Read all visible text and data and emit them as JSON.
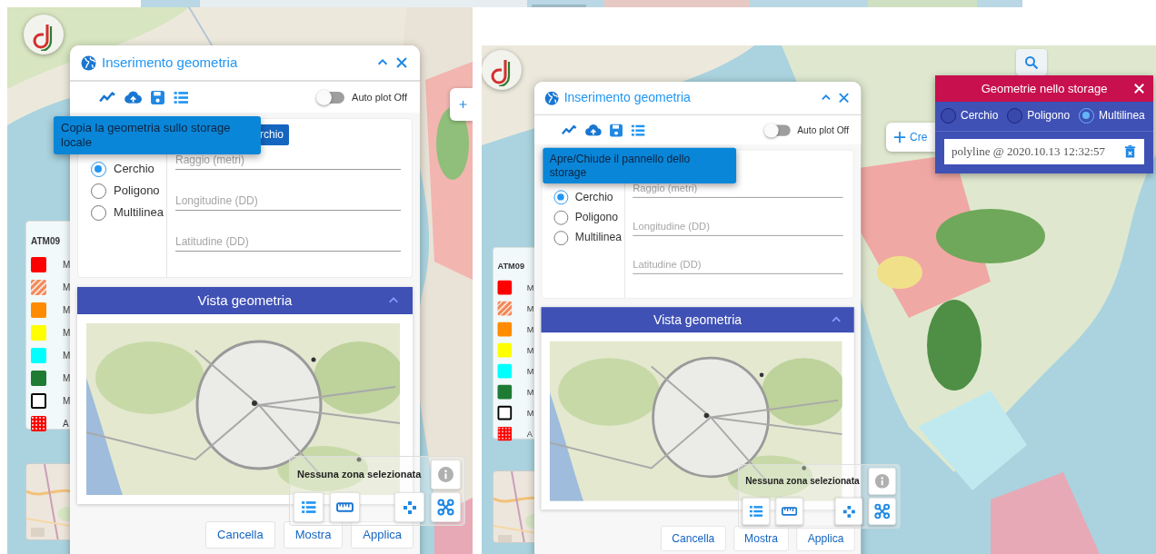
{
  "panes": [
    {
      "dialog": {
        "title": "Inserimento geometria",
        "auto_plot": {
          "label": "Auto plot Off",
          "on": false
        },
        "tooltip": "Copia la geometria sullo storage locale",
        "tab_label": "rchio",
        "shapes": [
          {
            "label": "Cerchio",
            "selected": true
          },
          {
            "label": "Poligono",
            "selected": false
          },
          {
            "label": "Multilinea",
            "selected": false
          }
        ],
        "fields": [
          {
            "placeholder": "Raggio (metri)"
          },
          {
            "placeholder": "Longitudine (DD)"
          },
          {
            "placeholder": "Latitudine (DD)"
          }
        ],
        "section_title": "Vista geometria",
        "buttons": [
          {
            "label": "Cancella"
          },
          {
            "label": "Mostra"
          },
          {
            "label": "Applica"
          }
        ]
      },
      "legend": {
        "title": "ATM09",
        "items": [
          {
            "label": "M",
            "color": "#ff0000",
            "kind": "solid"
          },
          {
            "label": "M",
            "color": "#f08a5d",
            "kind": "hatched"
          },
          {
            "label": "M",
            "color": "#ff8c00",
            "kind": "solid"
          },
          {
            "label": "M",
            "color": "#ffff00",
            "kind": "solid"
          },
          {
            "label": "M",
            "color": "#00ffff",
            "kind": "solid"
          },
          {
            "label": "M",
            "color": "#1e7b34",
            "kind": "solid"
          },
          {
            "label": "M",
            "color": "#000000",
            "kind": "outline"
          },
          {
            "label": "A",
            "color": "#ff0000",
            "kind": "dotted"
          }
        ]
      },
      "zone_panel": {
        "text": "Nessuna zona selezionata"
      },
      "create_button": {
        "kind": "icon_only"
      }
    },
    {
      "dialog": {
        "title": "Inserimento geometria",
        "auto_plot": {
          "label": "Auto plot Off",
          "on": false
        },
        "tooltip": "Apre/Chiude il pannello dello storage",
        "shapes": [
          {
            "label": "Cerchio",
            "selected": true
          },
          {
            "label": "Poligono",
            "selected": false
          },
          {
            "label": "Multilinea",
            "selected": false
          }
        ],
        "fields": [
          {
            "placeholder": "Raggio (metri)"
          },
          {
            "placeholder": "Longitudine (DD)"
          },
          {
            "placeholder": "Latitudine (DD)"
          }
        ],
        "section_title": "Vista geometria",
        "buttons": [
          {
            "label": "Cancella"
          },
          {
            "label": "Mostra"
          },
          {
            "label": "Applica"
          }
        ]
      },
      "legend": {
        "title": "ATM09",
        "items": [
          {
            "label": "M",
            "color": "#ff0000",
            "kind": "solid"
          },
          {
            "label": "M",
            "color": "#f08a5d",
            "kind": "hatched"
          },
          {
            "label": "M",
            "color": "#ff8c00",
            "kind": "solid"
          },
          {
            "label": "M",
            "color": "#ffff00",
            "kind": "solid"
          },
          {
            "label": "M",
            "color": "#00ffff",
            "kind": "solid"
          },
          {
            "label": "M",
            "color": "#1e7b34",
            "kind": "solid"
          },
          {
            "label": "M",
            "color": "#000000",
            "kind": "outline"
          },
          {
            "label": "A",
            "color": "#ff0000",
            "kind": "dotted"
          }
        ]
      },
      "zone_panel": {
        "text": "Nessuna zona selezionata"
      },
      "create_button": {
        "kind": "with_label",
        "label": "Cre"
      },
      "search_button": true,
      "storage": {
        "title": "Geometrie nello storage",
        "shapes": [
          {
            "label": "Cerchio",
            "selected": false
          },
          {
            "label": "Poligono",
            "selected": false
          },
          {
            "label": "Multilinea",
            "selected": true
          }
        ],
        "items": [
          {
            "text": "polyline @ 2020.10.13 12:32:57"
          }
        ]
      }
    }
  ]
}
